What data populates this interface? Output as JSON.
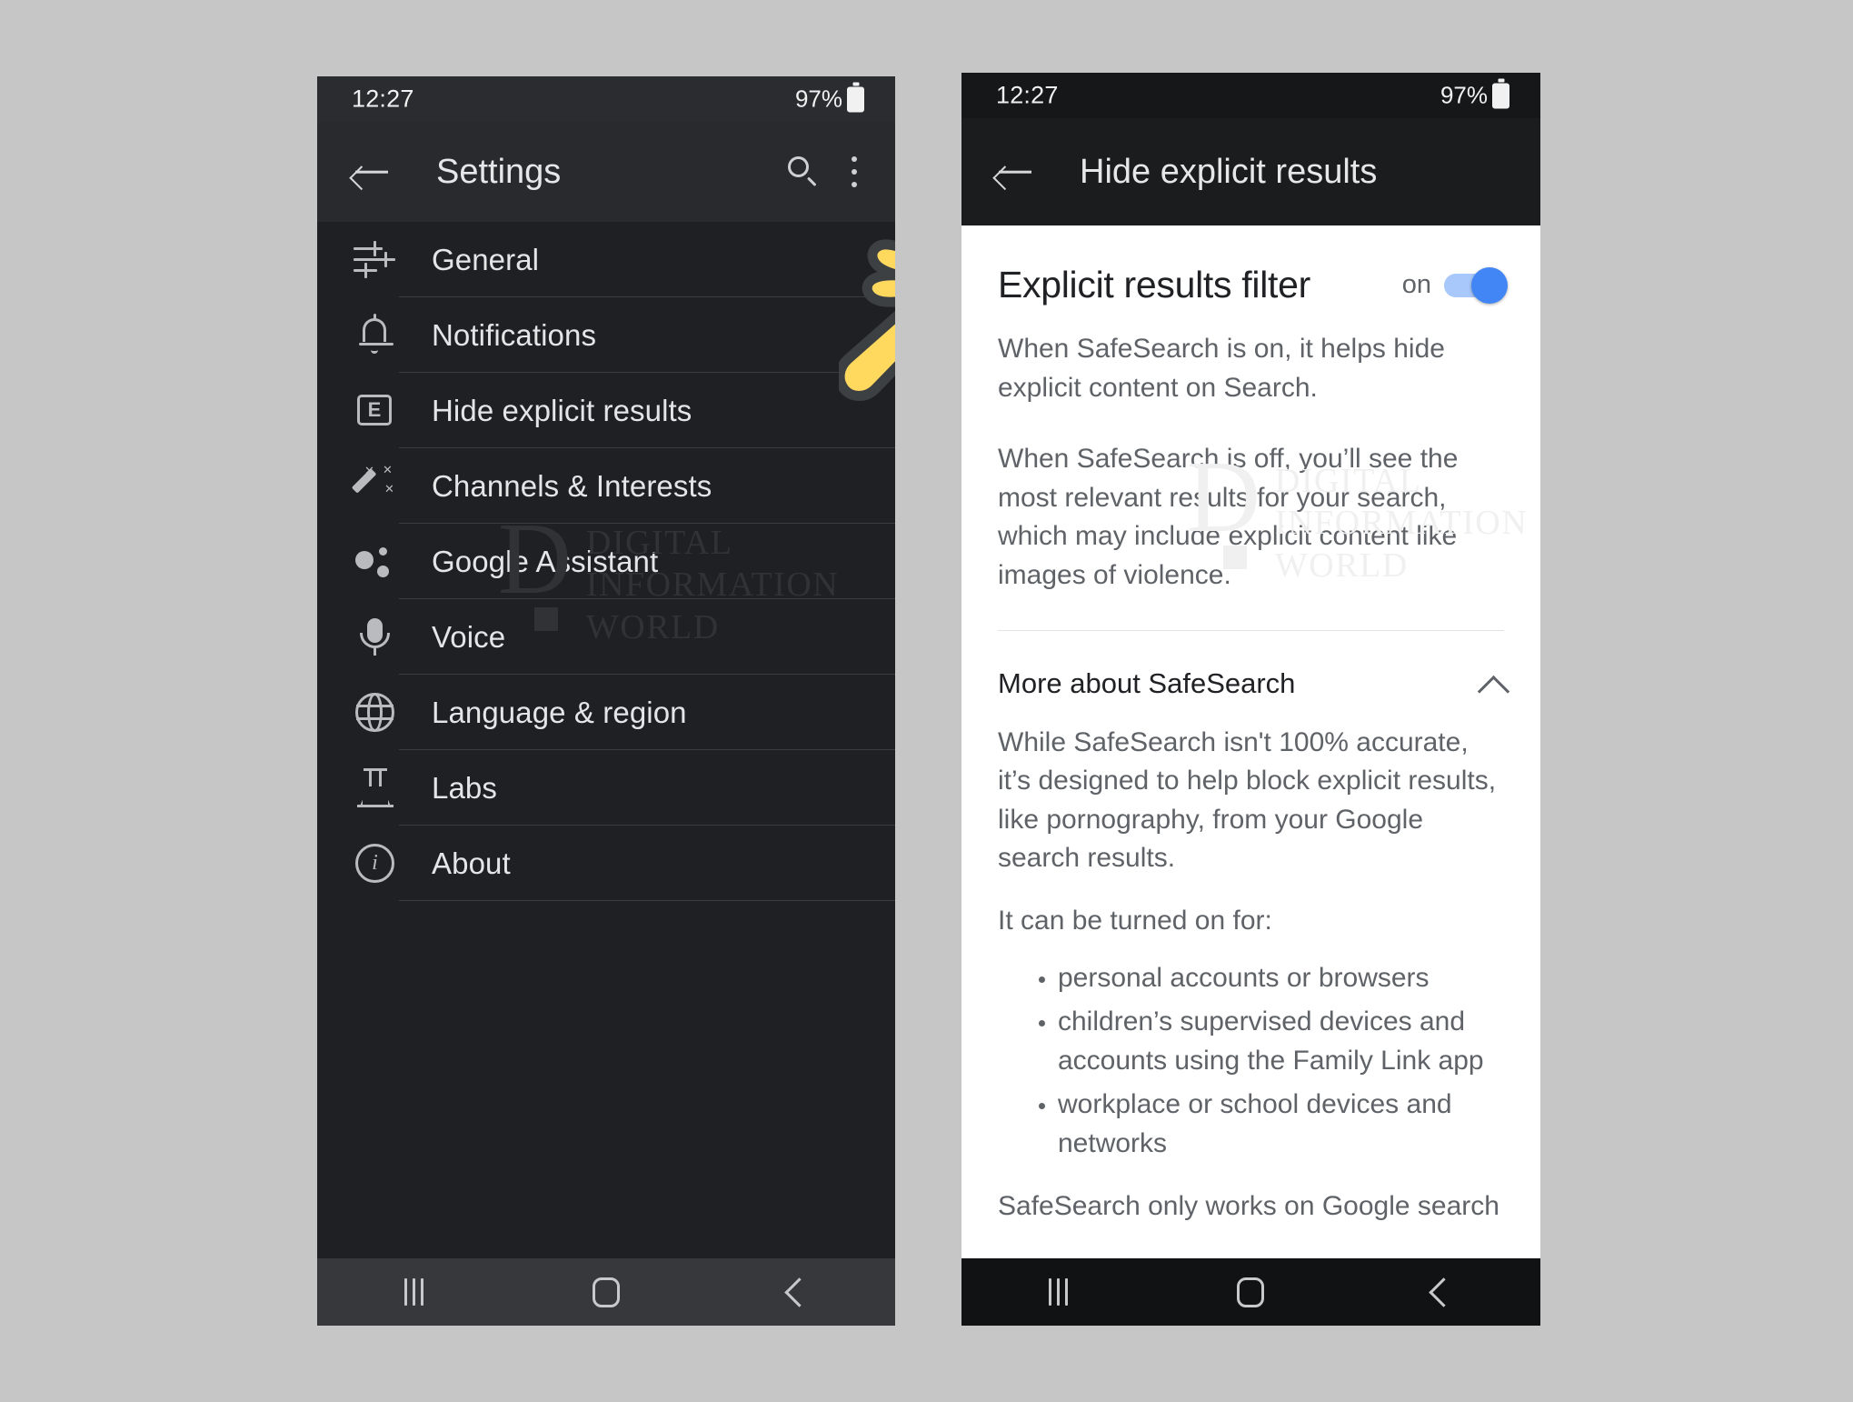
{
  "left_phone": {
    "status": {
      "time": "12:27",
      "battery": "97%",
      "battery_icon": "battery-full-icon"
    },
    "appbar": {
      "back_icon": "back-arrow-icon",
      "title": "Settings",
      "search_icon": "search-icon",
      "overflow_icon": "more-vertical-icon"
    },
    "menu": [
      {
        "label": "General",
        "icon": "tune-sliders-icon"
      },
      {
        "label": "Notifications",
        "icon": "bell-icon"
      },
      {
        "label": "Hide explicit results",
        "icon": "explicit-e-icon"
      },
      {
        "label": "Channels & Interests",
        "icon": "magic-wand-icon"
      },
      {
        "label": "Google Assistant",
        "icon": "assistant-dots-icon"
      },
      {
        "label": "Voice",
        "icon": "microphone-icon"
      },
      {
        "label": "Language & region",
        "icon": "globe-icon"
      },
      {
        "label": "Labs",
        "icon": "flask-icon"
      },
      {
        "label": "About",
        "icon": "info-circle-icon"
      }
    ],
    "navbar": {
      "recents": "recents-icon",
      "home": "home-icon",
      "back": "back-icon"
    }
  },
  "right_phone": {
    "status": {
      "time": "12:27",
      "battery": "97%",
      "battery_icon": "battery-full-icon"
    },
    "appbar": {
      "back_icon": "back-arrow-icon",
      "title": "Hide explicit results"
    },
    "filter": {
      "title": "Explicit results filter",
      "toggle_label": "on",
      "toggle_state": "on",
      "toggle_color": "#4285f4",
      "toggle_track_color": "#a8c7fa"
    },
    "paragraphs": [
      "When SafeSearch is on, it helps hide explicit content on Search.",
      "When SafeSearch is off, you’ll see the most relevant results for your search, which may include explicit content like images of violence."
    ],
    "more_section": {
      "title": "More about SafeSearch",
      "chevron_icon": "chevron-up-icon",
      "body": "While SafeSearch isn't 100% accurate, it’s designed to help block explicit results, like pornography, from your Google search results.",
      "list_intro": "It can be turned on for:",
      "list_items": [
        "personal accounts or browsers",
        "children’s supervised devices and accounts using the Family Link app",
        "workplace or school devices and networks"
      ],
      "truncated_line": "SafeSearch only works on Google search"
    },
    "navbar": {
      "recents": "recents-icon",
      "home": "home-icon",
      "back": "back-icon"
    }
  },
  "watermark": {
    "mark": "D",
    "line1": "DIGITAL",
    "line2": "INFORMATION",
    "line3": "WORLD"
  },
  "cursor": {
    "icon": "pointing-hand-cursor",
    "color": "#ffd95e"
  }
}
